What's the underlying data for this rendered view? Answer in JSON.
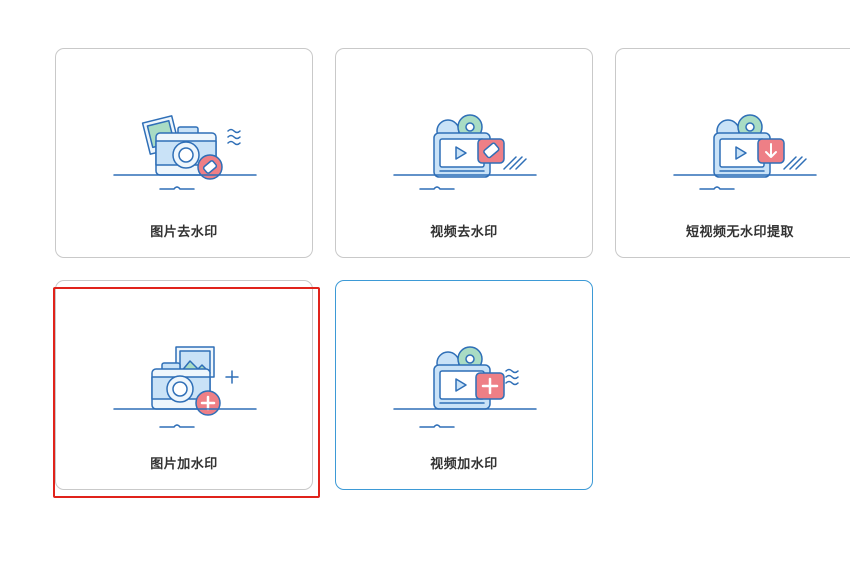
{
  "cards": [
    {
      "label": "图片去水印",
      "icon": "photo-remove-watermark-icon"
    },
    {
      "label": "视频去水印",
      "icon": "video-remove-watermark-icon"
    },
    {
      "label": "短视频无水印提取",
      "icon": "short-video-extract-icon"
    },
    {
      "label": "图片加水印",
      "icon": "photo-add-watermark-icon"
    },
    {
      "label": "视频加水印",
      "icon": "video-add-watermark-icon"
    }
  ],
  "colors": {
    "line": "#2f6fb7",
    "fill_blue": "#c9e2f7",
    "fill_green": "#a9dcc4",
    "accent_red": "#ee7f86",
    "active_border": "#3d9ad6",
    "highlight": "#e0231b"
  }
}
